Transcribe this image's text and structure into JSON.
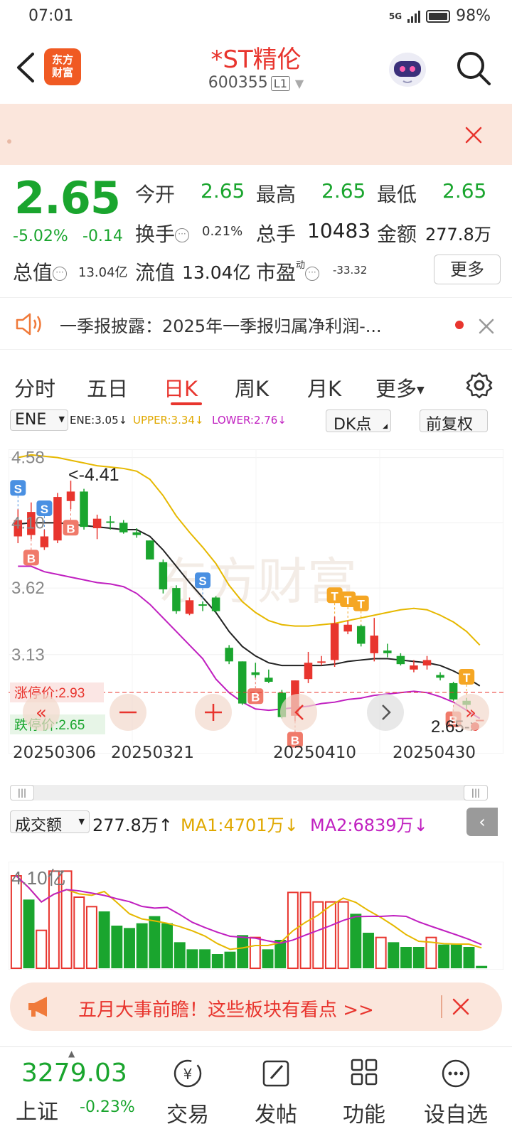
{
  "status": {
    "time": "07:01",
    "network": "5G",
    "battery": "98%"
  },
  "header": {
    "title": "*ST精伦",
    "code": "600355",
    "level": "L1",
    "logo_text": "东方财富"
  },
  "quote": {
    "price": "2.65",
    "change_pct": "-5.02%",
    "change_abs": "-0.14",
    "open_label": "今开",
    "open": "2.65",
    "high_label": "最高",
    "high": "2.65",
    "low_label": "最低",
    "low": "2.65",
    "turnover_label": "换手",
    "turnover": "0.21%",
    "volume_label": "总手",
    "volume": "10483",
    "amount_label": "金额",
    "amount": "277.8万",
    "mktcap_label": "总值",
    "mktcap": "13.04亿",
    "float_label": "流值",
    "float": "13.04亿",
    "pe_label": "市盈",
    "pe_sup": "动",
    "pe": "-33.32",
    "more": "更多"
  },
  "announcement": {
    "text": "一季报披露：2025年一季报归属净利润-..."
  },
  "tabs": [
    "分时",
    "五日",
    "日K",
    "周K",
    "月K",
    "更多"
  ],
  "active_tab": 2,
  "chart_controls": {
    "indicator": "ENE",
    "ene": "ENE:3.05",
    "upper": "UPPER:3.34",
    "lower": "LOWER:2.76",
    "dk": "DK点",
    "adjust": "前复权",
    "limit_up": "涨停价:2.93",
    "limit_down": "跌停价:2.65",
    "max_marker": "<-4.41",
    "last_marker": "2.65->",
    "y_labels": [
      "4.58",
      "4.10",
      "3.62",
      "3.13"
    ],
    "x_labels": [
      "20250306",
      "20250321",
      "20250410",
      "20250430"
    ]
  },
  "chart_data": {
    "type": "candlestick",
    "y_range": [
      2.59,
      4.62
    ],
    "candles": [
      {
        "o": 4.0,
        "c": 4.12,
        "h": 4.2,
        "l": 3.95
      },
      {
        "o": 4.01,
        "c": 4.18,
        "h": 4.25,
        "l": 3.98
      },
      {
        "o": 3.92,
        "c": 4.0,
        "h": 4.05,
        "l": 3.9
      },
      {
        "o": 3.97,
        "c": 4.29,
        "h": 4.32,
        "l": 3.95
      },
      {
        "o": 4.26,
        "c": 4.33,
        "h": 4.41,
        "l": 4.2
      },
      {
        "o": 4.33,
        "c": 4.07,
        "h": 4.35,
        "l": 4.05
      },
      {
        "o": 4.06,
        "c": 4.13,
        "h": 4.16,
        "l": 3.98
      },
      {
        "o": 4.11,
        "c": 4.1,
        "h": 4.15,
        "l": 4.05
      },
      {
        "o": 4.1,
        "c": 4.03,
        "h": 4.12,
        "l": 4.02
      },
      {
        "o": 4.03,
        "c": 4.01,
        "h": 4.06,
        "l": 3.99
      },
      {
        "o": 3.97,
        "c": 3.83,
        "h": 3.97,
        "l": 3.83
      },
      {
        "o": 3.81,
        "c": 3.61,
        "h": 3.83,
        "l": 3.58
      },
      {
        "o": 3.62,
        "c": 3.45,
        "h": 3.64,
        "l": 3.43
      },
      {
        "o": 3.43,
        "c": 3.53,
        "h": 3.55,
        "l": 3.42
      },
      {
        "o": 3.5,
        "c": 3.49,
        "h": 3.52,
        "l": 3.45
      },
      {
        "o": 3.55,
        "c": 3.45,
        "h": 3.56,
        "l": 3.44
      },
      {
        "o": 3.18,
        "c": 3.08,
        "h": 3.2,
        "l": 3.06
      },
      {
        "o": 3.08,
        "c": 2.77,
        "h": 3.08,
        "l": 2.76
      },
      {
        "o": 3.0,
        "c": 2.98,
        "h": 3.07,
        "l": 2.96
      },
      {
        "o": 2.96,
        "c": 2.93,
        "h": 3.02,
        "l": 2.92
      },
      {
        "o": 2.85,
        "c": 2.67,
        "h": 2.87,
        "l": 2.66
      },
      {
        "o": 2.68,
        "c": 2.94,
        "h": 2.94,
        "l": 2.64
      },
      {
        "o": 2.95,
        "c": 3.07,
        "h": 3.15,
        "l": 2.92
      },
      {
        "o": 3.08,
        "c": 3.08,
        "h": 3.12,
        "l": 3.05
      },
      {
        "o": 3.09,
        "c": 3.36,
        "h": 3.41,
        "l": 3.04
      },
      {
        "o": 3.3,
        "c": 3.35,
        "h": 3.38,
        "l": 3.28
      },
      {
        "o": 3.34,
        "c": 3.21,
        "h": 3.35,
        "l": 3.19
      },
      {
        "o": 3.14,
        "c": 3.27,
        "h": 3.4,
        "l": 3.08
      },
      {
        "o": 3.16,
        "c": 3.14,
        "h": 3.21,
        "l": 3.11
      },
      {
        "o": 3.12,
        "c": 3.06,
        "h": 3.14,
        "l": 3.05
      },
      {
        "o": 3.02,
        "c": 3.05,
        "h": 3.09,
        "l": 3.0
      },
      {
        "o": 3.05,
        "c": 3.09,
        "h": 3.12,
        "l": 3.02
      },
      {
        "o": 2.98,
        "c": 2.96,
        "h": 3.0,
        "l": 2.94
      },
      {
        "o": 2.92,
        "c": 2.8,
        "h": 2.93,
        "l": 2.79
      },
      {
        "o": 2.79,
        "c": 2.76,
        "h": 2.81,
        "l": 2.73
      },
      {
        "o": 2.65,
        "c": 2.65,
        "h": 2.65,
        "l": 2.65
      }
    ],
    "ene_mid": [
      4.09,
      4.1,
      4.1,
      4.1,
      4.09,
      4.08,
      4.07,
      4.06,
      4.05,
      4.05,
      4.0,
      3.9,
      3.78,
      3.66,
      3.55,
      3.44,
      3.3,
      3.19,
      3.12,
      3.07,
      3.05,
      3.05,
      3.05,
      3.05,
      3.06,
      3.08,
      3.09,
      3.1,
      3.1,
      3.09,
      3.08,
      3.07,
      3.05,
      3.01,
      2.96,
      2.9
    ],
    "ene_upper": [
      4.58,
      4.6,
      4.59,
      4.58,
      4.56,
      4.54,
      4.52,
      4.51,
      4.5,
      4.48,
      4.42,
      4.3,
      4.15,
      4.03,
      3.92,
      3.8,
      3.64,
      3.52,
      3.44,
      3.38,
      3.35,
      3.34,
      3.34,
      3.35,
      3.36,
      3.38,
      3.4,
      3.42,
      3.44,
      3.46,
      3.47,
      3.46,
      3.42,
      3.37,
      3.3,
      3.2
    ],
    "ene_lower": [
      3.78,
      3.78,
      3.74,
      3.72,
      3.7,
      3.68,
      3.66,
      3.65,
      3.63,
      3.58,
      3.5,
      3.4,
      3.3,
      3.2,
      3.1,
      2.95,
      2.85,
      2.78,
      2.73,
      2.72,
      2.73,
      2.74,
      2.75,
      2.77,
      2.78,
      2.8,
      2.81,
      2.83,
      2.84,
      2.85,
      2.86,
      2.85,
      2.82,
      2.78,
      2.72,
      2.66
    ],
    "signals": [
      {
        "i": 0,
        "type": "S"
      },
      {
        "i": 2,
        "type": "S"
      },
      {
        "i": 1,
        "type": "B"
      },
      {
        "i": 4,
        "type": "B"
      },
      {
        "i": 14,
        "type": "S"
      },
      {
        "i": 18,
        "type": "B"
      },
      {
        "i": 21,
        "type": "B"
      },
      {
        "i": 24,
        "type": "T"
      },
      {
        "i": 25,
        "type": "T"
      },
      {
        "i": 26,
        "type": "T"
      },
      {
        "i": 33,
        "type": "B"
      },
      {
        "i": 34,
        "type": "T"
      }
    ],
    "volume": {
      "indicator": "成交额",
      "current": "277.8万",
      "ma1": "MA1:4701万",
      "ma2": "MA2:6839万",
      "max_label": "4.10亿",
      "values": [
        3.9,
        2.9,
        1.6,
        4.1,
        4.1,
        3.0,
        2.6,
        2.4,
        1.8,
        1.7,
        1.9,
        2.2,
        1.9,
        1.1,
        0.8,
        0.8,
        0.6,
        0.7,
        1.4,
        1.3,
        0.8,
        1.2,
        3.2,
        3.2,
        2.8,
        2.8,
        2.8,
        2.3,
        1.5,
        1.3,
        1.1,
        0.9,
        0.9,
        1.3,
        1.0,
        1.0,
        0.9,
        0.1
      ],
      "up": [
        true,
        false,
        true,
        true,
        true,
        true,
        true,
        false,
        false,
        false,
        false,
        false,
        false,
        false,
        false,
        false,
        false,
        false,
        false,
        true,
        false,
        false,
        true,
        true,
        true,
        true,
        true,
        false,
        false,
        true,
        false,
        false,
        false,
        true,
        false,
        false,
        false,
        false
      ]
    }
  },
  "promo": {
    "text": "五月大事前瞻！这些板块有看点 >>"
  },
  "bottom_nav": {
    "index_value": "3279.03",
    "index_name": "上证",
    "index_change": "-0.23%",
    "items": [
      "交易",
      "发帖",
      "功能",
      "设自选"
    ]
  },
  "colors": {
    "up": "#e8352e",
    "down": "#1aa52e",
    "upper": "#e6b800",
    "lower": "#c020c0",
    "mid": "#222222"
  }
}
